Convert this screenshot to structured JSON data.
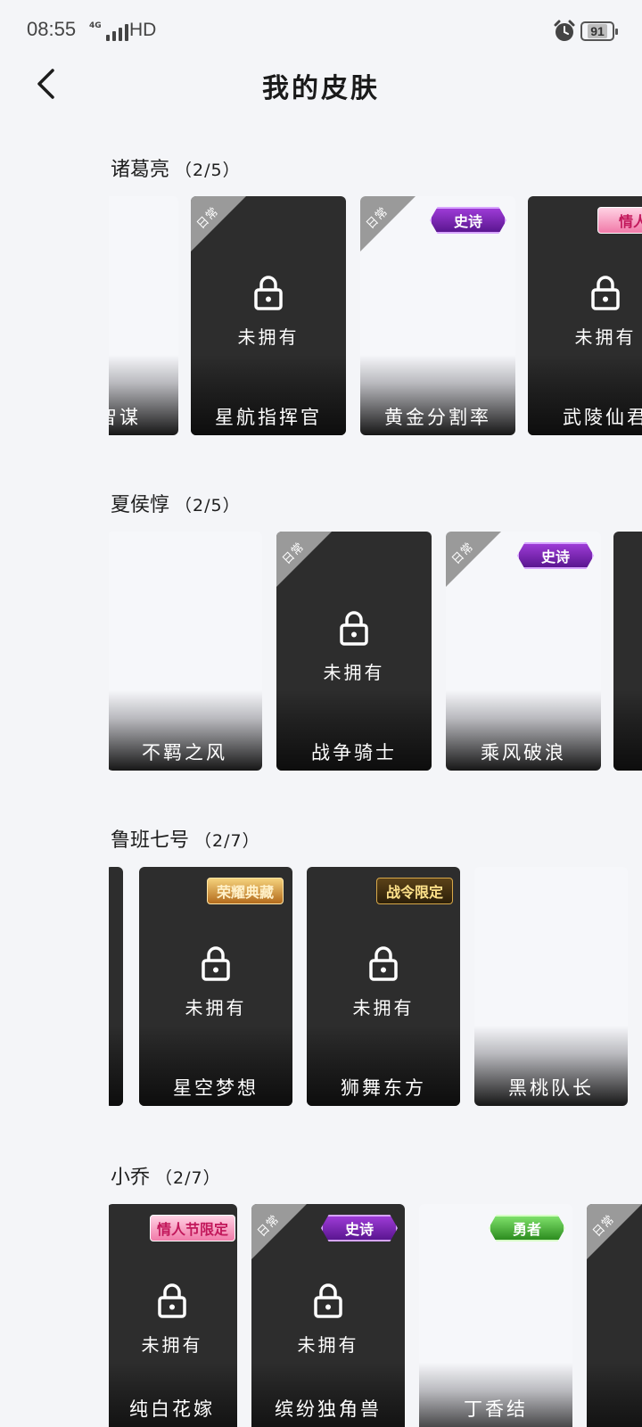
{
  "status_bar": {
    "time": "08:55",
    "network": "4G",
    "hd": "HD",
    "battery": "91"
  },
  "header": {
    "title": "我的皮肤"
  },
  "sections": [
    {
      "hero": "诸葛亮",
      "count": "（2/5）",
      "skins": [
        {
          "name": "智谋"
        },
        {
          "name": "星航指挥官",
          "ribbon": "日常",
          "status": "未拥有"
        },
        {
          "name": "黄金分割率",
          "ribbon": "日常",
          "badge": "史诗"
        },
        {
          "name": "武陵仙君",
          "badge": "情人节",
          "status": "未拥有"
        }
      ]
    },
    {
      "hero": "夏侯惇",
      "count": "（2/5）",
      "skins": [
        {
          "name": "不羁之风"
        },
        {
          "name": "战争骑士",
          "ribbon": "日常",
          "status": "未拥有"
        },
        {
          "name": "乘风破浪",
          "ribbon": "日常",
          "badge": "史诗"
        },
        {
          "name": ""
        }
      ]
    },
    {
      "hero": "鲁班七号",
      "count": "（2/7）",
      "skins": [
        {
          "name": ""
        },
        {
          "name": "星空梦想",
          "badge": "荣耀典藏",
          "status": "未拥有"
        },
        {
          "name": "狮舞东方",
          "badge": "战令限定",
          "status": "未拥有"
        },
        {
          "name": "黑桃队长"
        }
      ]
    },
    {
      "hero": "小乔",
      "count": "（2/7）",
      "skins": [
        {
          "name": "纯白花嫁",
          "badge": "情人节限定",
          "status": "未拥有"
        },
        {
          "name": "缤纷独角兽",
          "ribbon": "日常",
          "badge": "史诗",
          "status": "未拥有"
        },
        {
          "name": "丁香结",
          "badge": "勇者"
        },
        {
          "name": "",
          "ribbon": "日常"
        }
      ]
    }
  ],
  "icons": {
    "back": "chevron-left-icon",
    "lock": "lock-icon",
    "alarm": "alarm-icon"
  }
}
